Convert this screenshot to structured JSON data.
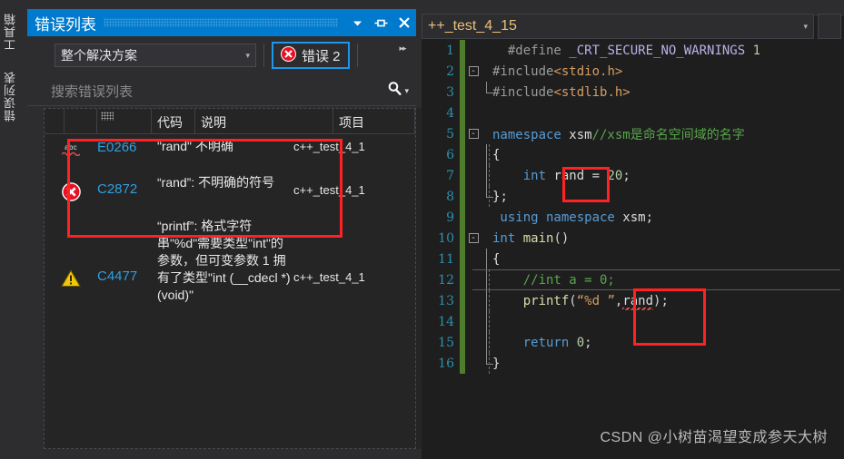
{
  "vertical_dock": {
    "tabs": [
      "工具箱",
      "错误列表"
    ]
  },
  "error_panel": {
    "title": "错误列表",
    "window_buttons": {
      "dropdown": "chevron-down-icon",
      "pin": "pin-icon",
      "close": "close-icon"
    },
    "scope_filter": {
      "value": "整个解决方案",
      "chevron": "▾"
    },
    "error_toggle": {
      "label": "错误 2",
      "icon": "error-circle-icon",
      "selected": true
    },
    "overflow_label": "▸▸",
    "search": {
      "placeholder": "搜索错误列表",
      "icon": "search-icon",
      "chevron": "▾"
    },
    "columns": [
      "",
      "",
      "",
      "代码",
      "说明",
      "项目"
    ],
    "rows": [
      {
        "icon": "intellisense-abc-icon",
        "code": "E0266",
        "description": "\"rand\" 不明确",
        "project": "c++_test_4_1"
      },
      {
        "icon": "error-circle-icon",
        "code": "C2872",
        "description": "“rand”: 不明确的符号",
        "project": "c++_test_4_1"
      },
      {
        "icon": "warning-triangle-icon",
        "code": "C4477",
        "description": "“printf”: 格式字符串\"%d\"需要类型\"int\"的参数，但可变参数 1 拥有了类型\"int (__cdecl *)(void)\"",
        "project": "c++_test_4_1"
      }
    ]
  },
  "editor": {
    "tab_name": "++_test_4_15",
    "tab_chevron": "▾",
    "lines": [
      {
        "n": "1",
        "fold": "",
        "html": "<span class=\"pp\">  #define </span><span class=\"macro\">_CRT_SECURE_NO_WARNINGS</span><span class=\"op\"> </span><span class=\"num\">1</span>"
      },
      {
        "n": "2",
        "fold": "-",
        "html": "<span class=\"pp\">#include</span><span class=\"str\">&lt;stdio.h&gt;</span>"
      },
      {
        "n": "3",
        "fold": "",
        "html": "<span class=\"pp\">#include</span><span class=\"str\">&lt;stdlib.h&gt;</span>"
      },
      {
        "n": "4",
        "fold": "",
        "html": ""
      },
      {
        "n": "5",
        "fold": "-",
        "html": "<span class=\"kw\">namespace</span><span class=\"id\"> xsm</span><span class=\"cmt\">//xsm是命名空间域的名字</span>"
      },
      {
        "n": "6",
        "fold": "",
        "html": "<span class=\"brace\">{</span>"
      },
      {
        "n": "7",
        "fold": "",
        "html": "<span class=\"kw\">    int </span><span class=\"id\">rand</span><span class=\"op\"> = </span><span class=\"num\">20</span><span class=\"op\">;</span>"
      },
      {
        "n": "8",
        "fold": "",
        "html": "<span class=\"brace\">}</span><span class=\"op\">;</span>"
      },
      {
        "n": "9",
        "fold": "",
        "html": "<span class=\"kw\"> using namespace</span><span class=\"id\"> xsm</span><span class=\"op\">;</span>"
      },
      {
        "n": "10",
        "fold": "-",
        "html": "<span class=\"kw\">int </span><span class=\"fn\">main</span><span class=\"op\">()</span>"
      },
      {
        "n": "11",
        "fold": "",
        "html": "<span class=\"brace\">{</span>"
      },
      {
        "n": "12",
        "fold": "",
        "html": "<span class=\"cmt\">    //int a = 0;</span>"
      },
      {
        "n": "13",
        "fold": "",
        "html": "<span class=\"op\">    </span><span class=\"fn\">printf</span><span class=\"op\">(</span><span class=\"str\">“%d ”</span><span class=\"op\">,</span><span class=\"id squig\">rand</span><span class=\"op\">);</span>"
      },
      {
        "n": "14",
        "fold": "",
        "html": ""
      },
      {
        "n": "15",
        "fold": "",
        "html": "<span class=\"kw\">    return </span><span class=\"num\">0</span><span class=\"op\">;</span>"
      },
      {
        "n": "16",
        "fold": "",
        "html": "<span class=\"brace\">}</span>"
      }
    ]
  },
  "annotations": {
    "boxes": [
      "error-rows-highlight",
      "rand-declaration-highlight",
      "rand-usage-highlight"
    ],
    "color": "#ff2222"
  },
  "watermark": "CSDN @小树苗渴望变成参天大树"
}
